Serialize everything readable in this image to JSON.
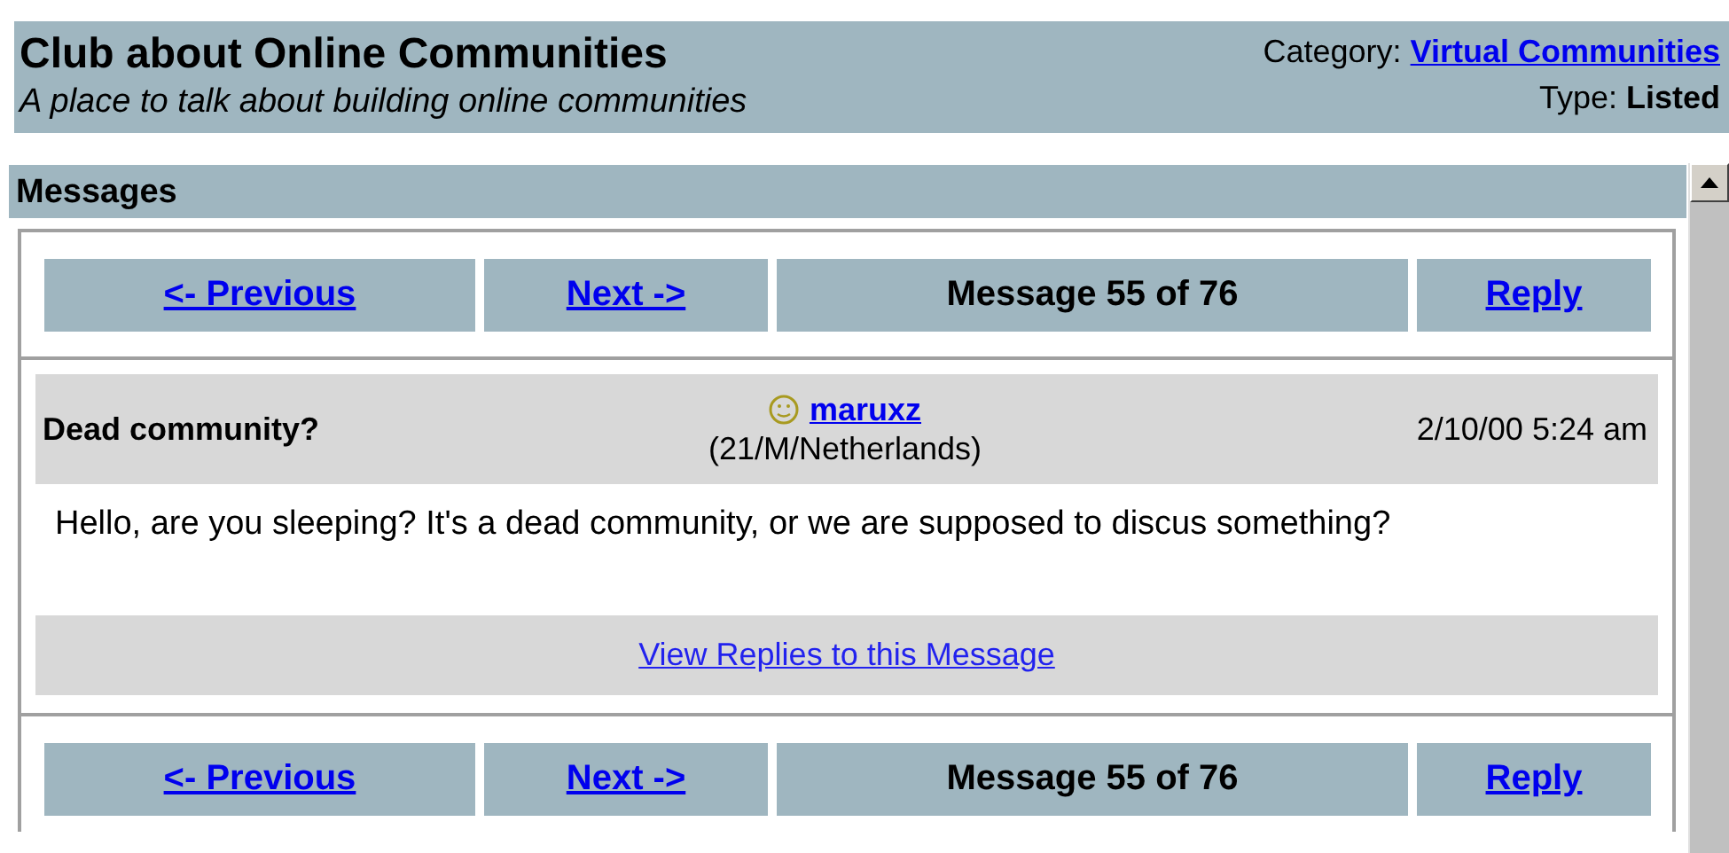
{
  "club": {
    "title": "Club about Online Communities",
    "subtitle": "A place to talk about building online communities",
    "category_label": "Category:",
    "category": "Virtual Communities",
    "type_label": "Type:",
    "type": "Listed"
  },
  "section_title": "Messages",
  "nav_top": {
    "previous": "<- Previous",
    "next": "Next ->",
    "position": "Message 55 of 76",
    "reply": "Reply"
  },
  "message": {
    "subject": "Dead community?",
    "author": "maruxz",
    "author_info": "(21/M/Netherlands)",
    "date": "2/10/00 5:24 am",
    "body": "Hello, are you sleeping? It's a dead community, or we are supposed to discus something?",
    "replies_link": "View Replies to this Message"
  },
  "nav_bottom": {
    "previous": "<- Previous",
    "next": "Next ->",
    "position": "Message 55 of 76",
    "reply": "Reply"
  }
}
